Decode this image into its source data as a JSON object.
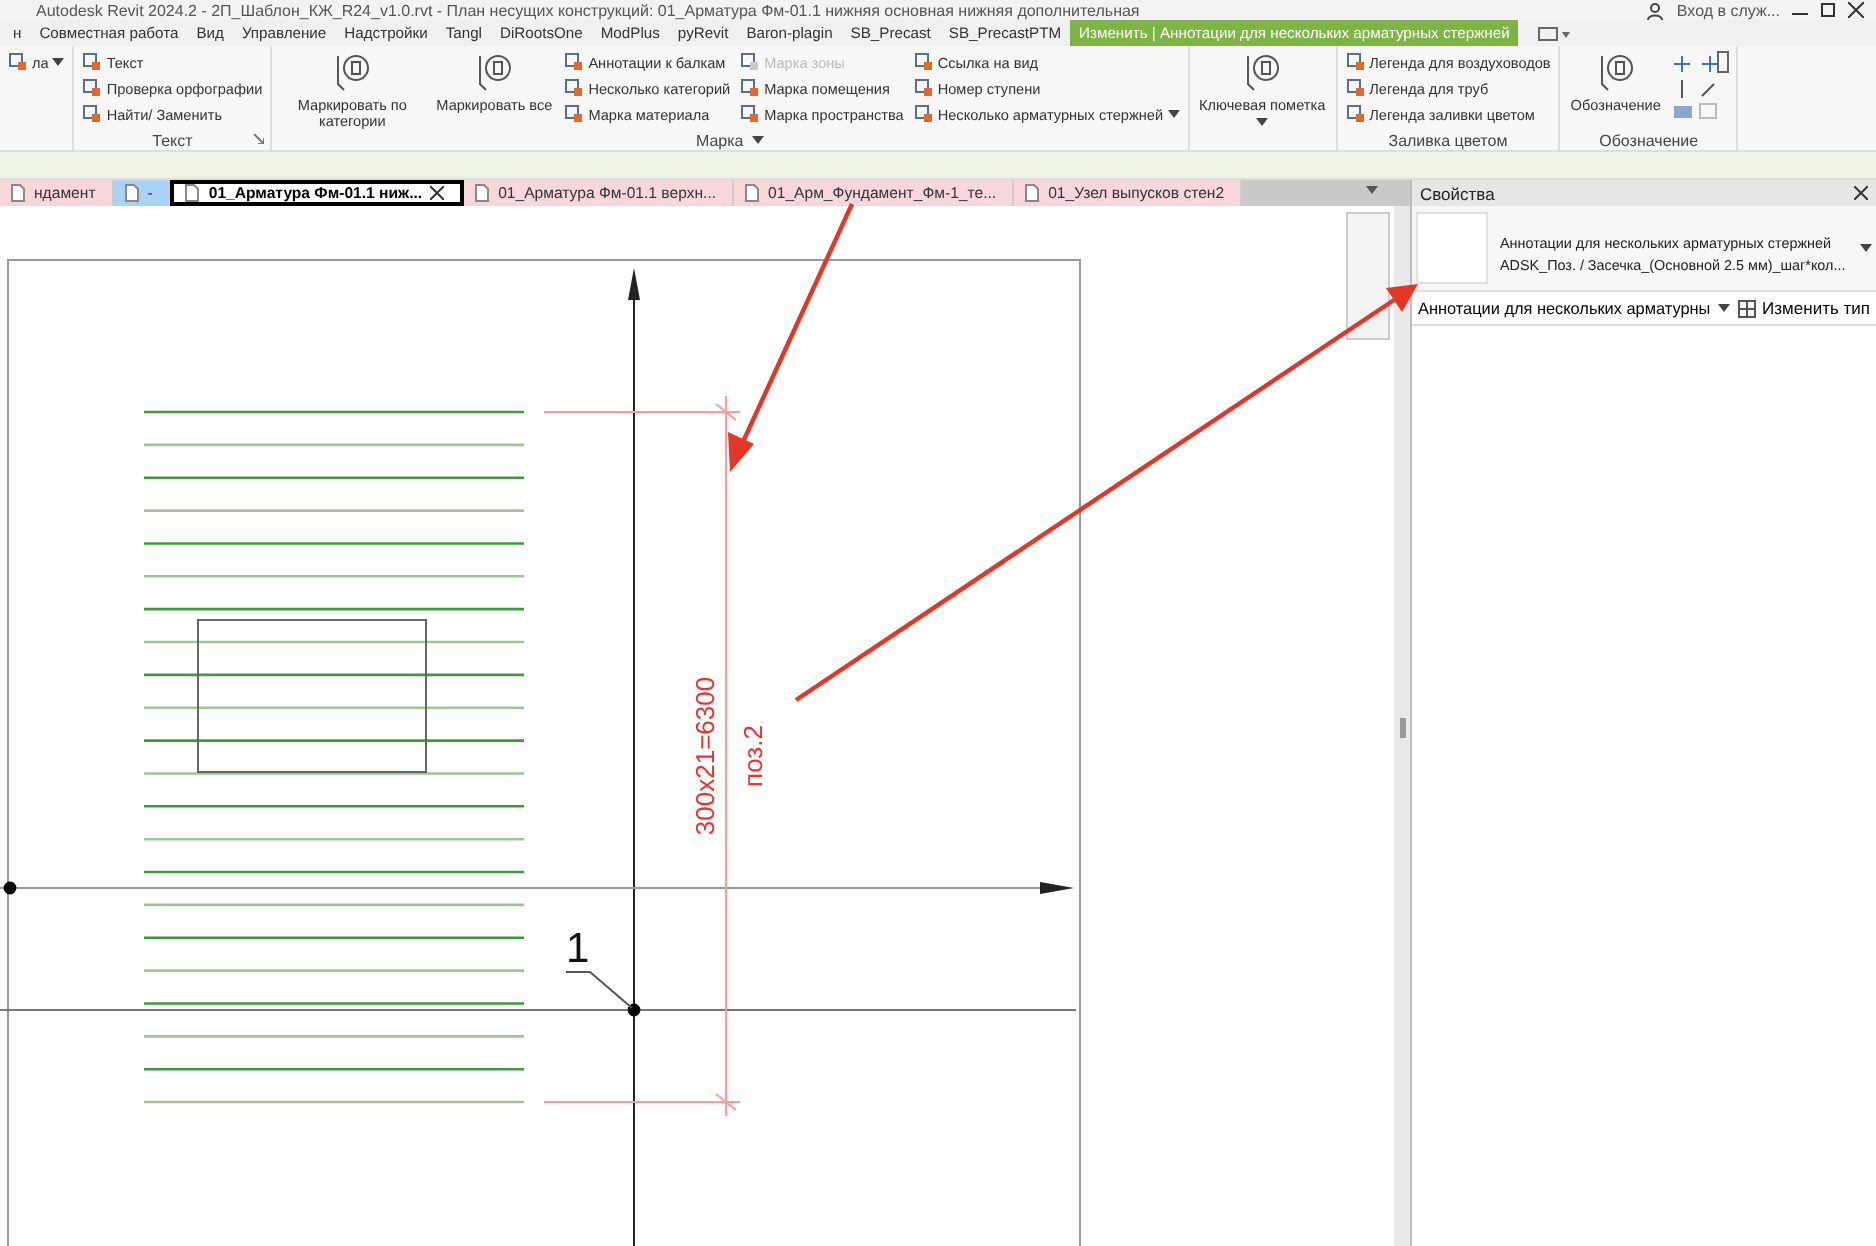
{
  "window": {
    "title": "Autodesk Revit 2024.2 - 2П_Шаблон_КЖ_R24_v1.0.rvt - План несущих конструкций: 01_Арматура Фм-01.1 нижняя основная нижняя дополнительная",
    "sign_in": "Вход в служ..."
  },
  "menu_tabs": [
    {
      "label": "н",
      "selected": false
    },
    {
      "label": "Совместная работа",
      "selected": false
    },
    {
      "label": "Вид",
      "selected": false
    },
    {
      "label": "Управление",
      "selected": false
    },
    {
      "label": "Надстройки",
      "selected": false
    },
    {
      "label": "Tangl",
      "selected": false
    },
    {
      "label": "DiRootsOne",
      "selected": false
    },
    {
      "label": "ModPlus",
      "selected": false
    },
    {
      "label": "pyRevit",
      "selected": false
    },
    {
      "label": "Baron-plagin",
      "selected": false
    },
    {
      "label": "SB_Precast",
      "selected": false
    },
    {
      "label": "SB_PrecastPTM",
      "selected": false
    },
    {
      "label": "Изменить | Аннотации для нескольких арматурных стержней",
      "selected": true
    }
  ],
  "ribbon": {
    "panels": [
      {
        "columns": [
          [
            {
              "label": "ла",
              "disabled": false,
              "menu": true
            }
          ]
        ]
      },
      {
        "title": "Текст",
        "launcher": true,
        "columns": [
          [
            {
              "label": "Текст",
              "disabled": false,
              "menu": false
            },
            {
              "label": "Проверка  орфографии",
              "disabled": false,
              "menu": false
            },
            {
              "label": "Найти/ Заменить",
              "disabled": false,
              "menu": false
            }
          ]
        ]
      },
      {
        "title": "Марка",
        "menu": true,
        "large": [
          {
            "label": "Маркировать по категории",
            "menu": false
          },
          {
            "label": "Маркировать все",
            "menu": false
          }
        ],
        "columns": [
          [
            {
              "label": "Аннотации к балкам",
              "disabled": false,
              "menu": false
            },
            {
              "label": "Несколько категорий",
              "disabled": false,
              "menu": false
            },
            {
              "label": "Марка материала",
              "disabled": false,
              "menu": false
            }
          ],
          [
            {
              "label": "Марка зоны",
              "disabled": true,
              "menu": false
            },
            {
              "label": "Марка помещения",
              "disabled": false,
              "menu": false
            },
            {
              "label": "Марка пространства",
              "disabled": false,
              "menu": false
            }
          ],
          [
            {
              "label": "Ссылка на вид",
              "disabled": false,
              "menu": false
            },
            {
              "label": "Номер  ступени",
              "disabled": false,
              "menu": false
            },
            {
              "label": "Несколько  арматурных стержней",
              "disabled": false,
              "menu": true
            }
          ]
        ]
      },
      {
        "large": [
          {
            "label": "Ключевая пометка",
            "menu": true
          }
        ]
      },
      {
        "title": "Заливка цветом",
        "columns": [
          [
            {
              "label": "Легенда для воздуховодов",
              "disabled": false,
              "menu": false
            },
            {
              "label": "Легенда для труб",
              "disabled": false,
              "menu": false
            },
            {
              "label": "Легенда заливки цветом",
              "disabled": false,
              "menu": false
            }
          ]
        ]
      },
      {
        "title": "Обозначение",
        "large": [
          {
            "label": "Обозначение",
            "menu": false
          }
        ],
        "icon_tools": true
      }
    ]
  },
  "view_tabs": [
    {
      "label": "ндамент",
      "selected": false,
      "color": "#f8d7dc"
    },
    {
      "label": "-",
      "selected": false,
      "color": "#a9d3f5"
    },
    {
      "label": "01_Арматура Фм-01.1 ниж...",
      "selected": true,
      "color": "#ffffff"
    },
    {
      "label": "01_Арматура Фм-01.1 верхн...",
      "selected": false,
      "color": "#f8d7dc"
    },
    {
      "label": "01_Арм_Фундамент_Фм-1_те...",
      "selected": false,
      "color": "#f8d7dc"
    },
    {
      "label": "01_Узел выпусков стен2",
      "selected": false,
      "color": "#f8d7dc"
    }
  ],
  "drawing": {
    "tag": "1",
    "dimension": "300x21=6300",
    "position_mark": "поз.2"
  },
  "properties": {
    "title": "Свойства",
    "type_name": "Аннотации для нескольких арматурных стержней",
    "type_detail": "ADSK_Поз. / Засечка_(Основной 2.5 мм)_шаг*кол...",
    "selector": "Аннотации для нескольких арматурны",
    "edit_type": "Изменить тип"
  }
}
